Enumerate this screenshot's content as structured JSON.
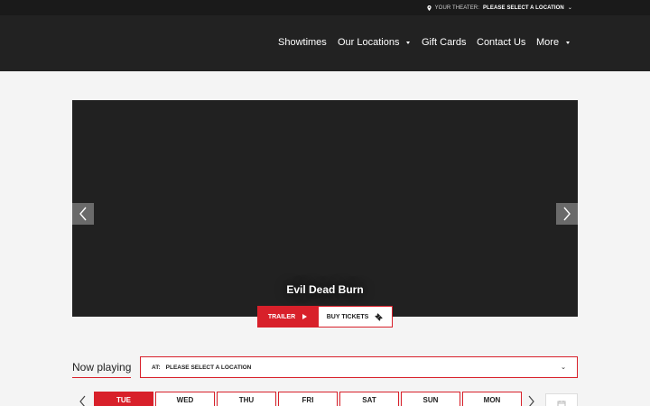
{
  "topbar": {
    "theater_label": "YOUR THEATER:",
    "theater_value": "PLEASE SELECT A LOCATION",
    "caret": "⌄",
    "pin_icon": "map-pin-icon"
  },
  "nav": {
    "items": [
      {
        "label": "Showtimes",
        "has_dropdown": false
      },
      {
        "label": "Our Locations",
        "has_dropdown": true
      },
      {
        "label": "Gift Cards",
        "has_dropdown": false
      },
      {
        "label": "Contact Us",
        "has_dropdown": false
      },
      {
        "label": "More",
        "has_dropdown": true
      }
    ]
  },
  "hero": {
    "title": "Evil Dead Burn",
    "trailer_label": "TRAILER",
    "tickets_label": "BUY TICKETS",
    "prev_icon": "chevron-left-icon",
    "next_icon": "chevron-right-icon"
  },
  "now_playing": {
    "heading": "Now playing",
    "at_label": "AT:",
    "location_value": "PLEASE SELECT A LOCATION",
    "chevron": "⌄"
  },
  "days": [
    "TUE",
    "WED",
    "THU",
    "FRI",
    "SAT",
    "SUN",
    "MON"
  ],
  "colors": {
    "accent": "#d8202a",
    "nav_bg": "#222222",
    "topbar_bg": "#1a1a1a",
    "page_bg": "#f4f4f4",
    "hero_bg": "#212121"
  }
}
